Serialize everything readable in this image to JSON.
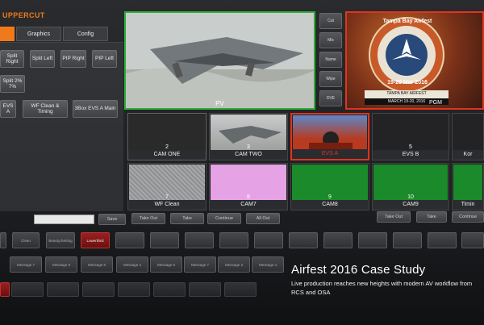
{
  "header": {
    "title": "UPPERCUT"
  },
  "tabs": [
    {
      "label": "",
      "active": true
    },
    {
      "label": "Graphics",
      "active": false
    },
    {
      "label": "Config",
      "active": false
    }
  ],
  "macro_buttons": [
    {
      "label": "Split Right"
    },
    {
      "label": "Split Left"
    },
    {
      "label": "PIP Right"
    },
    {
      "label": "PIP Left"
    },
    {
      "label": "Split 2% 7%"
    },
    {
      "label": "EVS A"
    },
    {
      "label": "WF Clean & Timing"
    },
    {
      "label": "3Box EVS A Main"
    }
  ],
  "preview": {
    "label": "PV"
  },
  "transitions": [
    {
      "label": "Cut"
    },
    {
      "label": "Mix"
    },
    {
      "label": "Name"
    },
    {
      "label": "Wipe"
    },
    {
      "label": "DVE"
    }
  ],
  "program": {
    "logo_title": "Tampa Bay Airfest",
    "logo_dates": "19-20 Mar 2016",
    "banner_line1": "TAMPA BAY AIRFEST",
    "banner_line2": "MARCH 19-20, 2016",
    "label": "PGM"
  },
  "sources": [
    {
      "num": "2",
      "label": "CAM ONE"
    },
    {
      "num": "3",
      "label": "CAM TWO"
    },
    {
      "num": "",
      "label": "EVS A"
    },
    {
      "num": "5",
      "label": "EVS B"
    },
    {
      "num": "",
      "label": "Kor"
    },
    {
      "num": "7",
      "label": "WF Clean"
    },
    {
      "num": "8",
      "label": "CAM7"
    },
    {
      "num": "9",
      "label": "CAM8"
    },
    {
      "num": "10",
      "label": "CAM9"
    },
    {
      "num": "",
      "label": "Timin"
    }
  ],
  "bottom_controls": {
    "save": "Save",
    "take_out": "Take Out",
    "take": "Take",
    "continue": "Continue",
    "all_out": "All Out",
    "take_out_2": "Take Out",
    "take_2": "Take",
    "continue_2": "Continue"
  },
  "folder_row": [
    "",
    "Clean",
    "Beauty/Setting",
    "Lowerthird"
  ],
  "message_row": [
    "Message 7",
    "Message 8",
    "Message 6",
    "Message 2",
    "Message 6",
    "Message 7",
    "Message 3",
    "Message 4"
  ],
  "caption": {
    "title": "Airfest 2016 Case Study",
    "subtitle": "Live production reaches new heights with modern AV workflow from RCS and OSA"
  }
}
